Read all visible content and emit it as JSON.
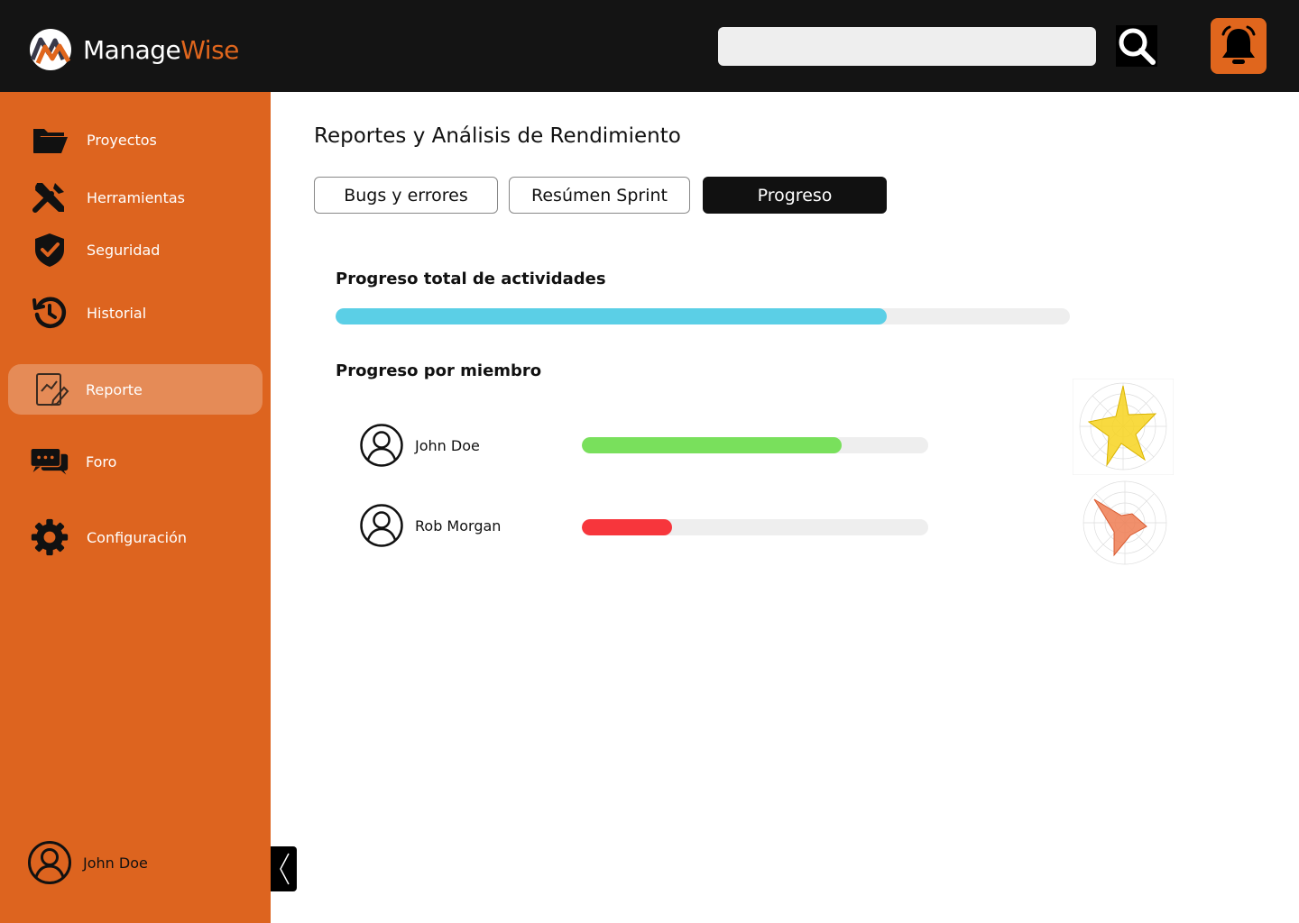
{
  "app": {
    "logo_part1": "Manage",
    "logo_part2": "Wise"
  },
  "header": {
    "search_placeholder": "",
    "search_value": ""
  },
  "sidebar": {
    "items": [
      {
        "label": "Proyectos",
        "icon": "folder-icon",
        "active": false
      },
      {
        "label": "Herramientas",
        "icon": "tools-icon",
        "active": false
      },
      {
        "label": "Seguridad",
        "icon": "shield-icon",
        "active": false
      },
      {
        "label": "Historial",
        "icon": "history-icon",
        "active": false
      },
      {
        "label": "Reporte",
        "icon": "report-icon",
        "active": true
      },
      {
        "label": "Foro",
        "icon": "chat-icon",
        "active": false
      },
      {
        "label": "Configuración",
        "icon": "gear-icon",
        "active": false
      }
    ],
    "user": {
      "name": "John Doe"
    }
  },
  "main": {
    "title": "Reportes y Análisis de Rendimiento",
    "tabs": [
      {
        "label": "Bugs y errores",
        "active": false
      },
      {
        "label": "Resúmen Sprint",
        "active": false
      },
      {
        "label": "Progreso",
        "active": true
      }
    ],
    "total": {
      "title": "Progreso total de actividades",
      "progress": 0.75,
      "color": "#5bcfe6"
    },
    "members_title": "Progreso por miembro",
    "members": [
      {
        "name": "John Doe",
        "progress": 0.75,
        "color": "#79e05c",
        "radar_color": "#f7d31f"
      },
      {
        "name": "Rob Morgan",
        "progress": 0.26,
        "color": "#f7363c",
        "radar_color": "#ef7d52"
      }
    ]
  },
  "colors": {
    "topbar": "#141414",
    "sidebar": "#dd641f",
    "accent": "#e0661d"
  }
}
